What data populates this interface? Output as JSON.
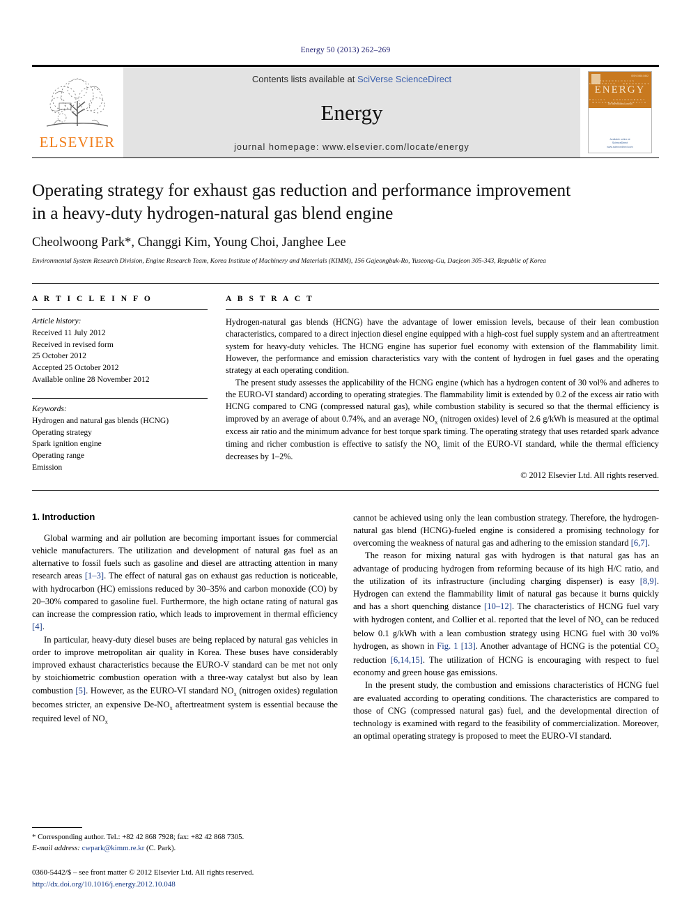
{
  "running_head": "Energy 50 (2013) 262–269",
  "masthead": {
    "publisher_name": "ELSEVIER",
    "contents_prefix": "Contents lists available at ",
    "sciencedirect_link": "SciVerse ScienceDirect",
    "journal_name": "Energy",
    "homepage_line": "journal homepage: www.elsevier.com/locate/energy",
    "cover": {
      "title": "ENERGY",
      "subtitle": "The international journal",
      "issue_code": "ISSN 0360-5442",
      "words_row1": "TECHNOLOGIES · ECONOMICS · RESOURCES · SOCIETY",
      "words_row2": "POLICY · ENVIRONMENT · MANAGEMENT · HEALTH",
      "foot_available": "Available online at",
      "foot_brand": "ScienceDirect",
      "foot_url": "www.sciencedirect.com"
    }
  },
  "article": {
    "title_line1": "Operating strategy for exhaust gas reduction and performance improvement",
    "title_line2": "in a heavy-duty hydrogen-natural gas blend engine",
    "authors": "Cheolwoong Park*, Changgi Kim, Young Choi, Janghee Lee",
    "affiliation": "Environmental System Research Division, Engine Research Team, Korea Institute of Machinery and Materials (KIMM), 156 Gajeongbuk-Ro, Yuseong-Gu, Daejeon 305-343, Republic of Korea"
  },
  "article_info": {
    "heading": "A R T I C L E   I N F O",
    "history_label": "Article history:",
    "history": [
      "Received 11 July 2012",
      "Received in revised form",
      "25 October 2012",
      "Accepted 25 October 2012",
      "Available online 28 November 2012"
    ],
    "keywords_label": "Keywords:",
    "keywords": [
      "Hydrogen and natural gas blends (HCNG)",
      "Operating strategy",
      "Spark ignition engine",
      "Operating range",
      "Emission"
    ]
  },
  "abstract": {
    "heading": "A B S T R A C T",
    "paragraph1": "Hydrogen-natural gas blends (HCNG) have the advantage of lower emission levels, because of their lean combustion characteristics, compared to a direct injection diesel engine equipped with a high-cost fuel supply system and an aftertreatment system for heavy-duty vehicles. The HCNG engine has superior fuel economy with extension of the flammability limit. However, the performance and emission characteristics vary with the content of hydrogen in fuel gases and the operating strategy at each operating condition.",
    "paragraph2_pre": "The present study assesses the applicability of the HCNG engine (which has a hydrogen content of 30 vol% and adheres to the EURO-VI standard) according to operating strategies. The flammability limit is extended by 0.2 of the excess air ratio with HCNG compared to CNG (compressed natural gas), while combustion stability is secured so that the thermal efficiency is improved by an average of about 0.74%, and an average NO",
    "paragraph2_sub": "x",
    "paragraph2_post": " (nitrogen oxides) level of 2.6 g/kWh is measured at the optimal excess air ratio and the minimum advance for best torque spark timing. The operating strategy that uses retarded spark advance timing and richer combustion is effective to satisfy the NO",
    "paragraph2_post2": " limit of the EURO-VI standard, while the thermal efficiency decreases by 1–2%.",
    "copyright": "© 2012 Elsevier Ltd. All rights reserved."
  },
  "introduction": {
    "heading": "1. Introduction",
    "left_p1_a": "Global warming and air pollution are becoming important issues for commercial vehicle manufacturers. The utilization and development of natural gas fuel as an alternative to fossil fuels such as gasoline and diesel are attracting attention in many research areas ",
    "left_p1_cite1": "[1–3]",
    "left_p1_b": ". The effect of natural gas on exhaust gas reduction is noticeable, with hydrocarbon (HC) emissions reduced by 30–35% and carbon monoxide (CO) by 20–30% compared to gasoline fuel. Furthermore, the high octane rating of natural gas can increase the compression ratio, which leads to improvement in thermal efficiency ",
    "left_p1_cite2": "[4]",
    "left_p1_c": ".",
    "left_p2_a": "In particular, heavy-duty diesel buses are being replaced by natural gas vehicles in order to improve metropolitan air quality in Korea. These buses have considerably improved exhaust characteristics because the EURO-V standard can be met not only by stoichiometric combustion operation with a three-way catalyst but also by lean combustion ",
    "left_p2_cite1": "[5]",
    "left_p2_b": ". However, as the EURO-VI standard NO",
    "left_p2_c": " (nitrogen oxides) regulation becomes stricter, an expensive De-NO",
    "left_p2_d": " aftertreatment system is essential because the required level of NO",
    "right_p1_a": "cannot be achieved using only the lean combustion strategy. Therefore, the hydrogen-natural gas blend (HCNG)-fueled engine is considered a promising technology for overcoming the weakness of natural gas and adhering to the emission standard ",
    "right_p1_cite1": "[6,7]",
    "right_p1_b": ".",
    "right_p2_a": "The reason for mixing natural gas with hydrogen is that natural gas has an advantage of producing hydrogen from reforming because of its high H/C ratio, and the utilization of its infrastructure (including charging dispenser) is easy ",
    "right_p2_cite1": "[8,9]",
    "right_p2_b": ". Hydrogen can extend the flammability limit of natural gas because it burns quickly and has a short quenching distance ",
    "right_p2_cite2": "[10–12]",
    "right_p2_c": ". The characteristics of HCNG fuel vary with hydrogen content, and Collier et al. reported that the level of NO",
    "right_p2_d": " can be reduced below 0.1 g/kWh with a lean combustion strategy using HCNG fuel with 30 vol% hydrogen, as shown in ",
    "right_p2_figref": "Fig. 1",
    "right_p2_e": " ",
    "right_p2_cite3": "[13]",
    "right_p2_f": ". Another advantage of HCNG is the potential CO",
    "right_p2_g": " reduction ",
    "right_p2_cite4": "[6,14,15]",
    "right_p2_h": ". The utilization of HCNG is encouraging with respect to fuel economy and green house gas emissions.",
    "right_p3": "In the present study, the combustion and emissions characteristics of HCNG fuel are evaluated according to operating conditions. The characteristics are compared to those of CNG (compressed natural gas) fuel, and the developmental direction of technology is examined with regard to the feasibility of commercialization. Moreover, an optimal operating strategy is proposed to meet the EURO-VI standard."
  },
  "footnote": {
    "corresponding": "* Corresponding author. Tel.: +82 42 868 7928; fax: +82 42 868 7305.",
    "email_label": "E-mail address:",
    "email": "cwpark@kimm.re.kr",
    "email_suffix": " (C. Park).",
    "issn_line": "0360-5442/$ – see front matter © 2012 Elsevier Ltd. All rights reserved.",
    "doi_line": "http://dx.doi.org/10.1016/j.energy.2012.10.048"
  },
  "colors": {
    "elsevier_orange": "#F07D1A",
    "citation_blue": "#1a3c87",
    "link_blue": "#3a5fad",
    "banner_gray": "#e3e3e3",
    "cover_orange": "#C8791F"
  }
}
